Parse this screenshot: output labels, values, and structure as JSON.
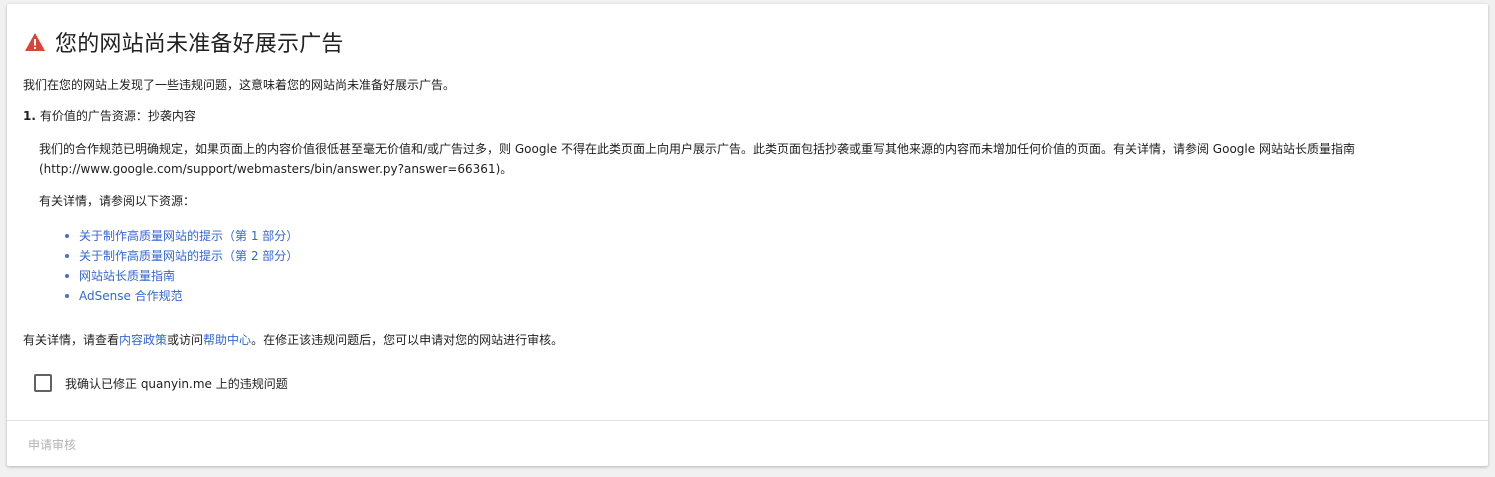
{
  "header": {
    "title": "您的网站尚未准备好展示广告",
    "icon": "warning-icon",
    "icon_color": "#db4437"
  },
  "intro": "我们在您的网站上发现了一些违规问题，这意味着您的网站尚未准备好展示广告。",
  "issue": {
    "number": "1.",
    "title": "有价值的广告资源：抄袭内容",
    "body": "我们的合作规范已明确规定，如果页面上的内容价值很低甚至毫无价值和/或广告过多，则 Google 不得在此类页面上向用户展示广告。此类页面包括抄袭或重写其他来源的内容而未增加任何价值的页面。有关详情，请参阅 Google 网站站长质量指南 (http://www.google.com/support/webmasters/bin/answer.py?answer=66361)。",
    "resources_label": "有关详情，请参阅以下资源：",
    "resources": [
      "关于制作高质量网站的提示（第 1 部分）",
      "关于制作高质量网站的提示（第 2 部分）",
      "网站站长质量指南",
      "AdSense 合作规范"
    ]
  },
  "more_info": {
    "prefix": "有关详情，请查看",
    "link1": "内容政策",
    "middle": "或访问",
    "link2": "帮助中心",
    "suffix": "。在修正该违规问题后，您可以申请对您的网站进行审核。"
  },
  "confirm": {
    "label": "我确认已修正 quanyin.me 上的违规问题",
    "checked": false
  },
  "submit_label": "申请审核",
  "colors": {
    "link": "#3367d6",
    "disabled_text": "#b4b4b4"
  }
}
